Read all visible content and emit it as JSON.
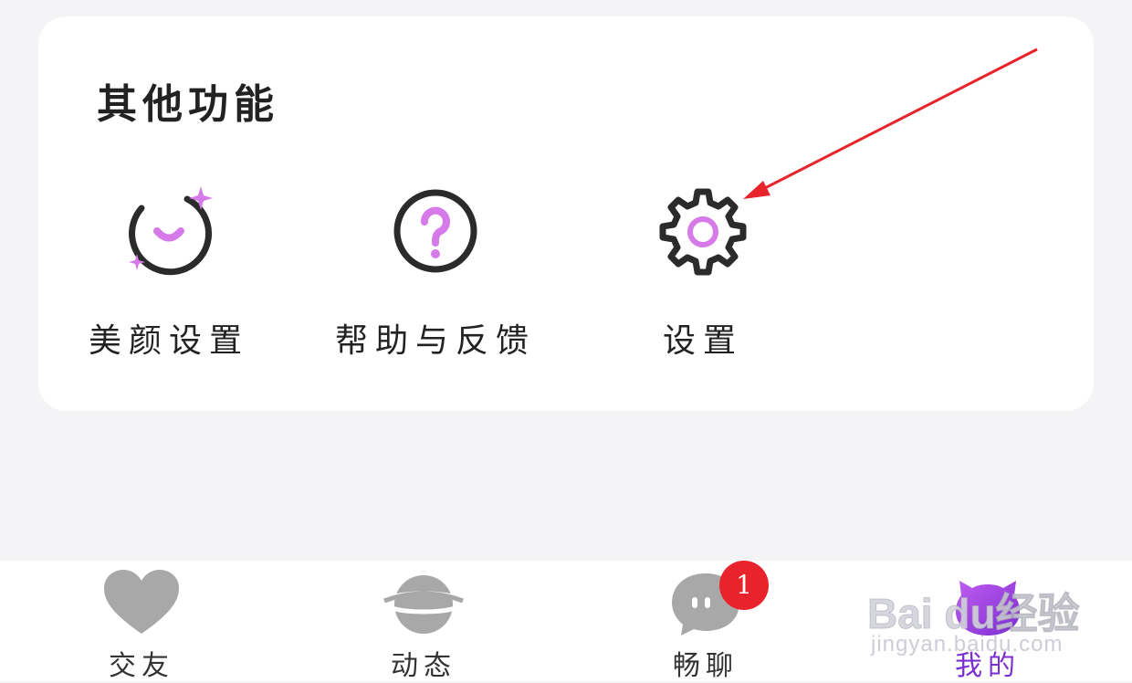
{
  "section": {
    "title": "其他功能",
    "items": [
      {
        "label": "美颜设置",
        "icon": "beauty-icon"
      },
      {
        "label": "帮助与反馈",
        "icon": "help-icon"
      },
      {
        "label": "设置",
        "icon": "gear-icon"
      }
    ]
  },
  "tabbar": {
    "items": [
      {
        "label": "交友",
        "icon": "heart-icon"
      },
      {
        "label": "动态",
        "icon": "planet-icon"
      },
      {
        "label": "畅聊",
        "icon": "chat-bubble-icon",
        "badge": "1"
      },
      {
        "label": "我的",
        "icon": "mine-icon",
        "active": true
      }
    ]
  },
  "watermark": {
    "brand": "Bai du经验",
    "sub": "jingyan.baidu.com"
  },
  "colors": {
    "accent": "#d57ae8",
    "active": "#7b2fd0",
    "icon_dark": "#2b2b2b",
    "tab_inactive": "#a8a8a8",
    "badge": "#e8232b",
    "arrow": "#e8232b"
  }
}
